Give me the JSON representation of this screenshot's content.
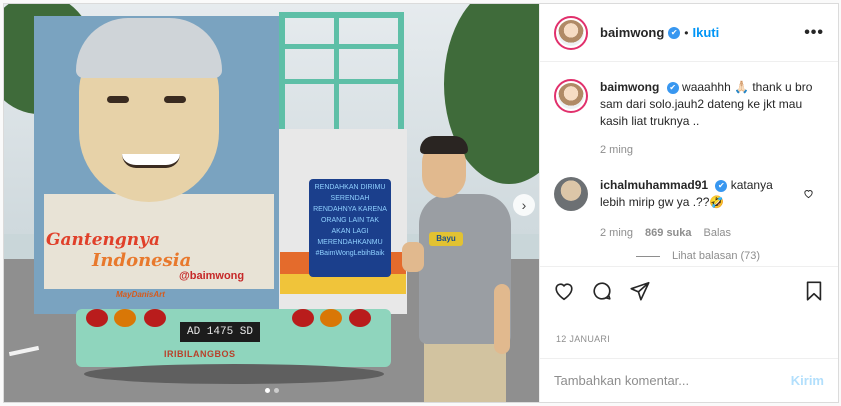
{
  "post": {
    "username": "baimwong",
    "verified_mark": "✔",
    "separator": "•",
    "follow_label": "Ikuti",
    "more_label": "•••",
    "photo": {
      "truck_slogan_1": "Gantengnya",
      "truck_slogan_2": "Indonesia",
      "truck_handle": "@baimwong",
      "truck_signature": "MayDanisArt",
      "plate": "AD 1475 SD",
      "bumper_text": "IRIBILANGBOS",
      "quote_text": "RENDAHKAN DIRIMU SERENDAH RENDAHNYA KARENA ORANG LAIN TAK AKAN LAGI MERENDAHKANMU #BaimWongLebihBaik",
      "shirt_logo": "Bayu",
      "next_arrow": "›",
      "slides": [
        true,
        false
      ]
    },
    "caption": {
      "username": "baimwong",
      "text": "waaahhh 🙏🏻 thank u bro sam dari solo.jauh2 dateng ke jkt mau kasih liat truknya ..",
      "time": "2 ming"
    },
    "comment": {
      "username": "ichalmuhammad91",
      "text": "katanya lebih mirip gw ya .??🤣",
      "time": "2 ming",
      "likes": "869 suka",
      "reply_label": "Balas",
      "view_replies": "Lihat balasan (73)"
    },
    "date": "12 JANUARI",
    "add_comment_placeholder": "Tambahkan komentar...",
    "post_button": "Kirim"
  },
  "colors": {
    "accent": "#0095f6",
    "post_button_disabled": "#b2dffc",
    "muted": "#8e8e8e",
    "verified": "#3897f0"
  },
  "icons": [
    "heart-icon",
    "comment-icon",
    "share-icon",
    "bookmark-icon",
    "small-heart-icon",
    "chevron-right-icon",
    "more-icon"
  ]
}
